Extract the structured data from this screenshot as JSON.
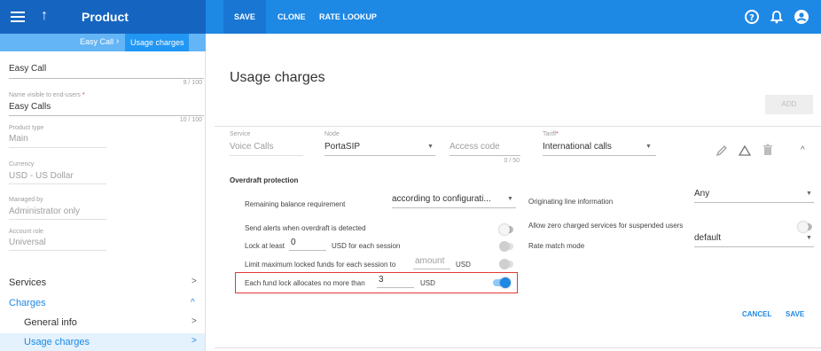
{
  "header": {
    "title": "Product",
    "actions": [
      "SAVE",
      "CLONE",
      "RATE LOOKUP"
    ],
    "icons": [
      "help-icon",
      "bell-icon",
      "account-icon"
    ]
  },
  "breadcrumb": {
    "parent": "Easy Call",
    "current": "Usage charges"
  },
  "sidebar": {
    "name_value": "Easy Call",
    "name_counter": "9 / 100",
    "visible_name_label": "Name visible to end-users",
    "visible_name_required": "*",
    "visible_name_value": "Easy Calls",
    "visible_name_counter": "10 / 100",
    "product_type_label": "Product type",
    "product_type_value": "Main",
    "currency_label": "Currency",
    "currency_value": "USD - US Dollar",
    "managed_by_label": "Managed by",
    "managed_by_value": "Administrator only",
    "account_role_label": "Account role",
    "account_role_value": "Universal",
    "nav": {
      "services": "Services",
      "charges": "Charges",
      "general_info": "General info",
      "usage_charges": "Usage charges"
    }
  },
  "main": {
    "title": "Usage charges",
    "add_label": "ADD",
    "service_label": "Service",
    "service_value": "Voice Calls",
    "node_label": "Node",
    "node_value": "PortaSIP",
    "access_code_placeholder": "Access code",
    "access_code_counter": "0 / 50",
    "tariff_label": "Tariff",
    "tariff_required": "*",
    "tariff_value": "International calls",
    "overdraft_heading": "Overdraft protection",
    "remaining_balance_label": "Remaining balance requirement",
    "remaining_balance_value": "according to configurati...",
    "send_alerts_label": "Send alerts when overdraft is detected",
    "lock_at_least_label": "Lock at least",
    "lock_at_least_value": "0",
    "lock_at_least_suffix": "USD for each session",
    "limit_max_label": "Limit maximum locked funds for each session to",
    "limit_max_placeholder": "amount",
    "limit_max_suffix": "USD",
    "each_fund_label": "Each fund lock allocates no more than",
    "each_fund_value": "3",
    "each_fund_suffix": "USD",
    "originating_line_label": "Originating line information",
    "originating_line_value": "Any",
    "allow_zero_label": "Allow zero charged services for suspended users",
    "rate_match_label": "Rate match mode",
    "rate_match_value": "default",
    "cancel_label": "CANCEL",
    "save_label": "SAVE",
    "toggles": {
      "send_alerts": false,
      "lock_at_least": false,
      "limit_max": false,
      "each_fund": true,
      "allow_zero": false
    }
  },
  "colors": {
    "topbar": "#1e88e5",
    "accent": "#1e88e5",
    "highlight_border": "#e53935"
  }
}
